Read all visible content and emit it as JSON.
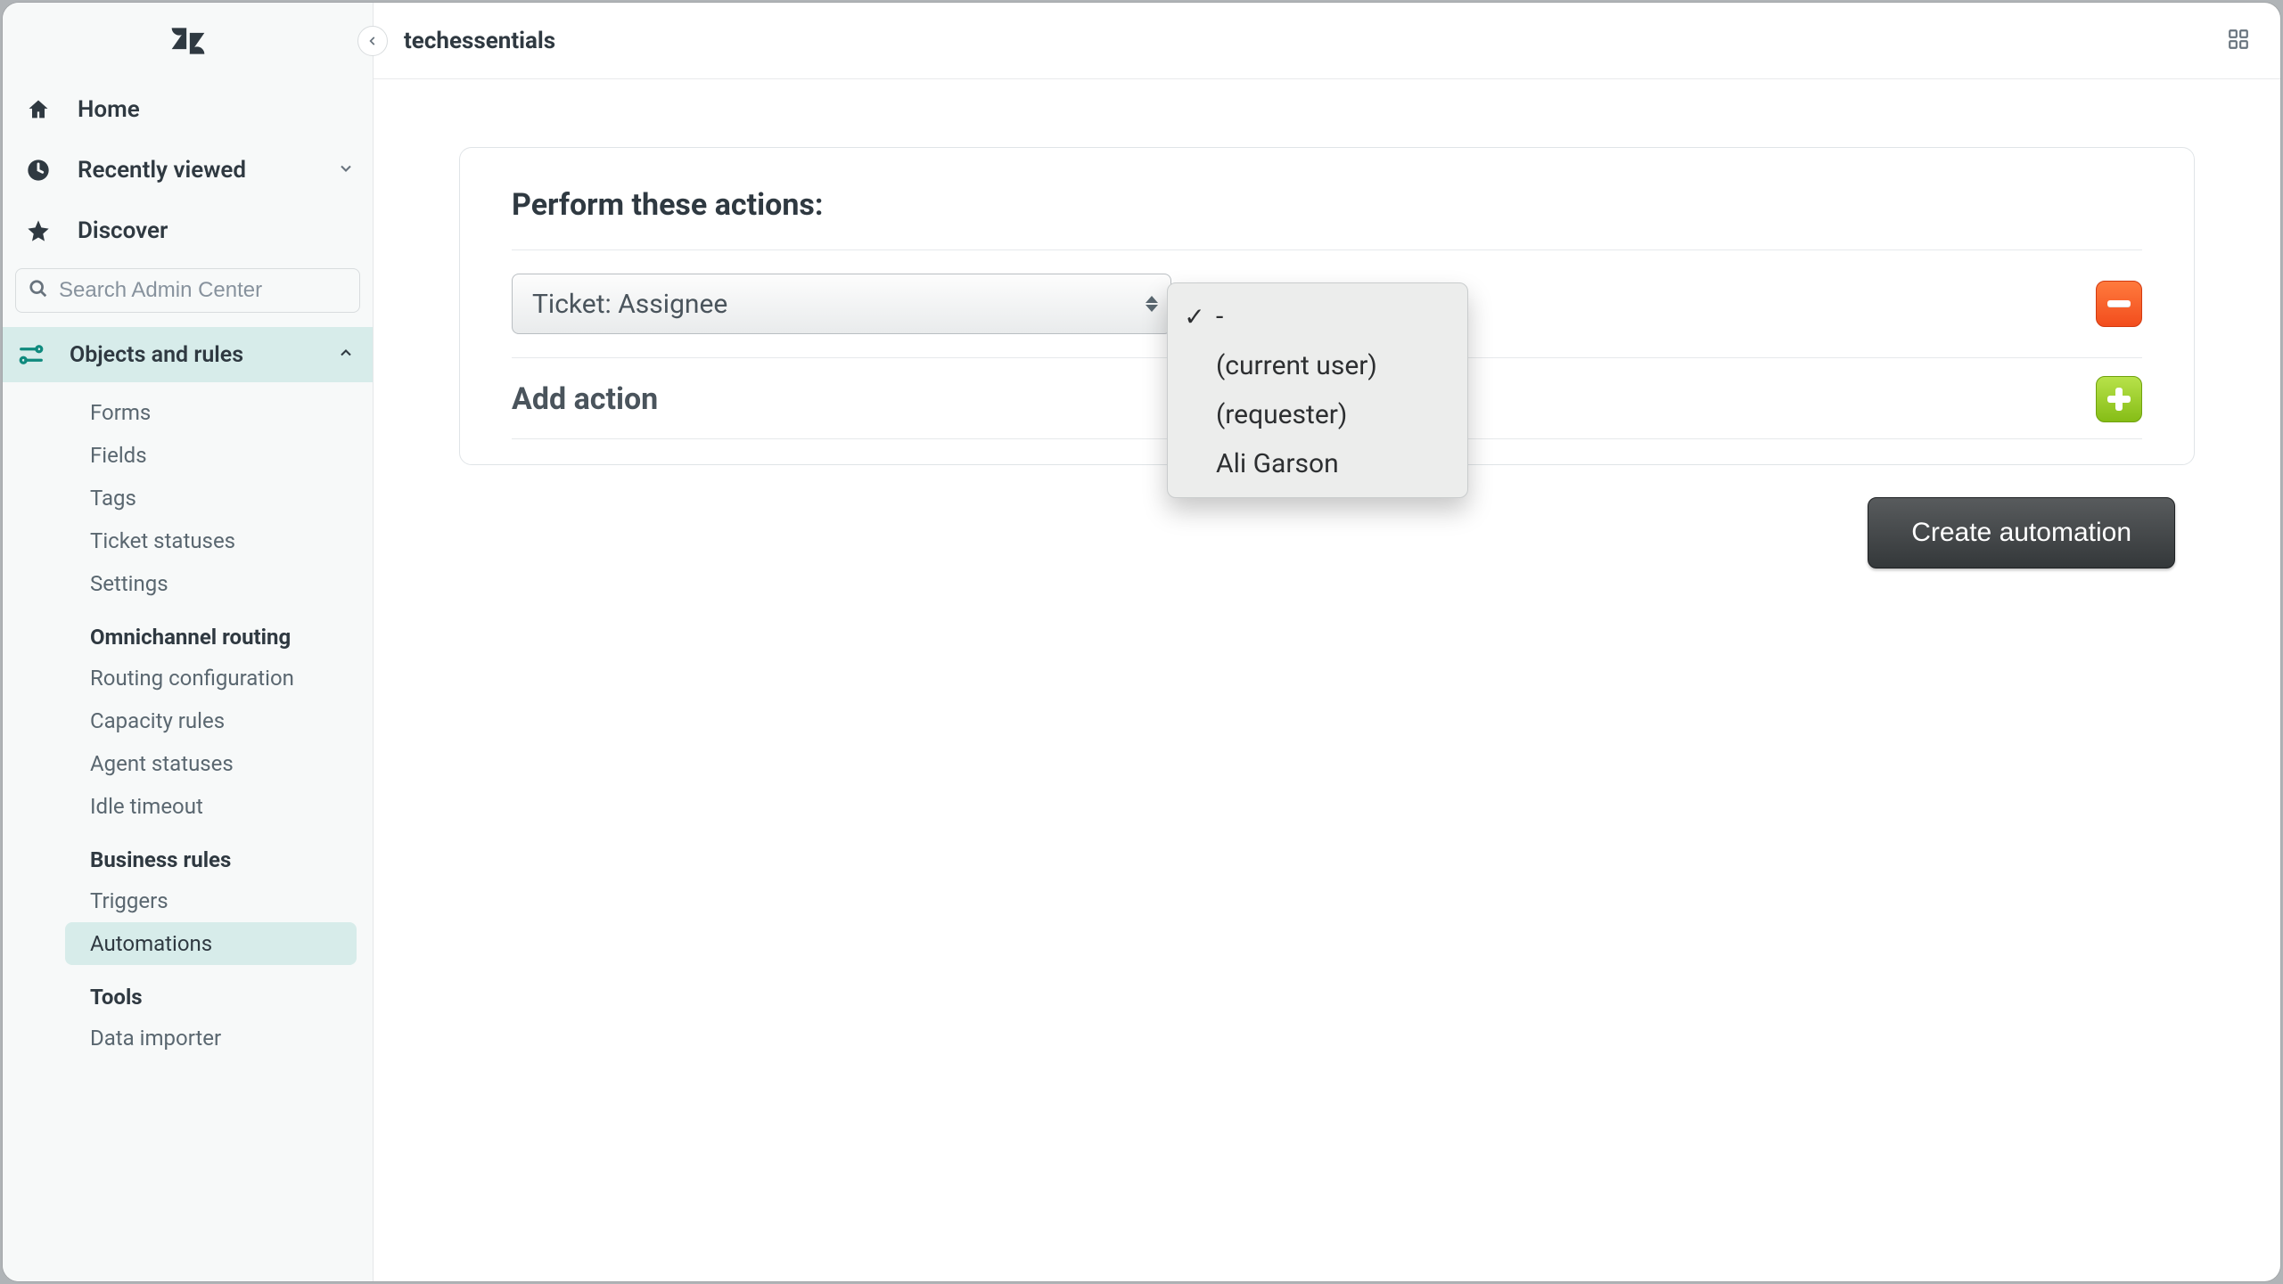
{
  "header": {
    "workspace": "techessentials"
  },
  "sidebar": {
    "nav": {
      "home": "Home",
      "recent": "Recently viewed",
      "discover": "Discover"
    },
    "search_placeholder": "Search Admin Center",
    "section": {
      "label": "Objects and rules"
    },
    "links": {
      "forms": "Forms",
      "fields": "Fields",
      "tags": "Tags",
      "ticket_statuses": "Ticket statuses",
      "settings": "Settings"
    },
    "groups": {
      "omni": {
        "title": "Omnichannel routing",
        "routing_config": "Routing configuration",
        "capacity_rules": "Capacity rules",
        "agent_statuses": "Agent statuses",
        "idle_timeout": "Idle timeout"
      },
      "biz": {
        "title": "Business rules",
        "triggers": "Triggers",
        "automations": "Automations"
      },
      "tools": {
        "title": "Tools",
        "data_importer": "Data importer"
      }
    }
  },
  "main": {
    "panel_title": "Perform these actions:",
    "action_select_label": "Ticket: Assignee",
    "add_action_label": "Add action",
    "submit_label": "Create automation"
  },
  "dropdown": {
    "options": {
      "dash": "-",
      "current_user": "(current user)",
      "requester": "(requester)",
      "ali": "Ali Garson"
    },
    "selected_index": 0
  }
}
